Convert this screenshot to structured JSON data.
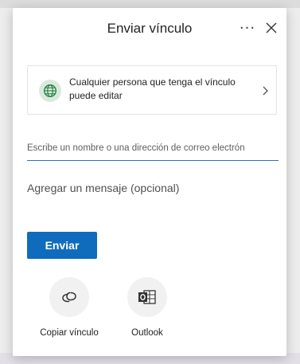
{
  "dialog": {
    "title": "Enviar vínculo",
    "more_label": "···",
    "permission": {
      "text": "Cualquier persona que tenga el vínculo puede editar"
    },
    "recipients_placeholder": "Escribe un nombre o una dirección de correo electrón",
    "message_placeholder": "Agregar un mensaje (opcional)",
    "send_label": "Enviar",
    "share_options": [
      {
        "label": "Copiar vínculo",
        "icon": "link-icon"
      },
      {
        "label": "Outlook",
        "icon": "outlook-icon"
      }
    ]
  },
  "colors": {
    "accent": "#0f6cbd",
    "globe_bg": "#d9eadd",
    "globe_stroke": "#1e7a3c"
  }
}
